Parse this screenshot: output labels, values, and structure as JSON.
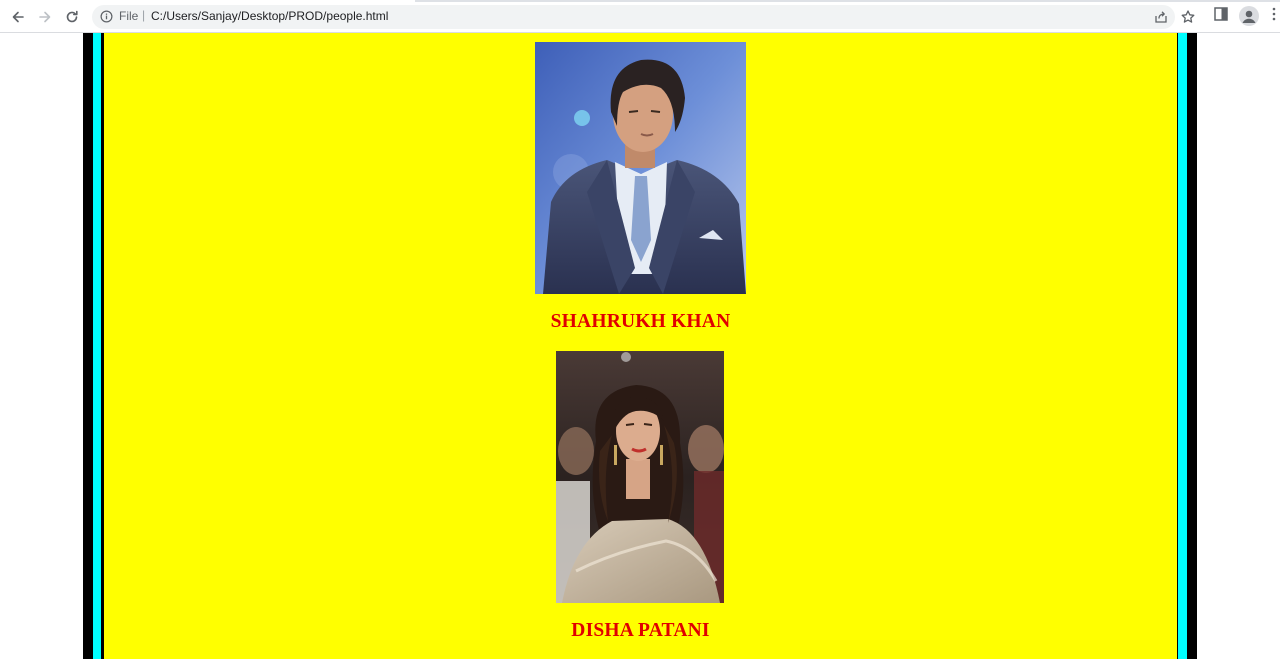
{
  "browser": {
    "scheme_label": "File",
    "separator": "|",
    "url": "C:/Users/Sanjay/Desktop/PROD/people.html",
    "icons": [
      "back-arrow-icon",
      "forward-arrow-icon",
      "reload-icon",
      "info-icon",
      "share-icon",
      "star-icon",
      "side-panel-icon",
      "profile-icon",
      "menu-icon"
    ]
  },
  "page": {
    "colors": {
      "background": "#ffff00",
      "outer_border": "#000000",
      "inner_border": "#00ffff",
      "name_text": "#e00000"
    },
    "people": [
      {
        "name": "SHAHRUKH KHAN"
      },
      {
        "name": "DISHA PATANI"
      }
    ]
  }
}
